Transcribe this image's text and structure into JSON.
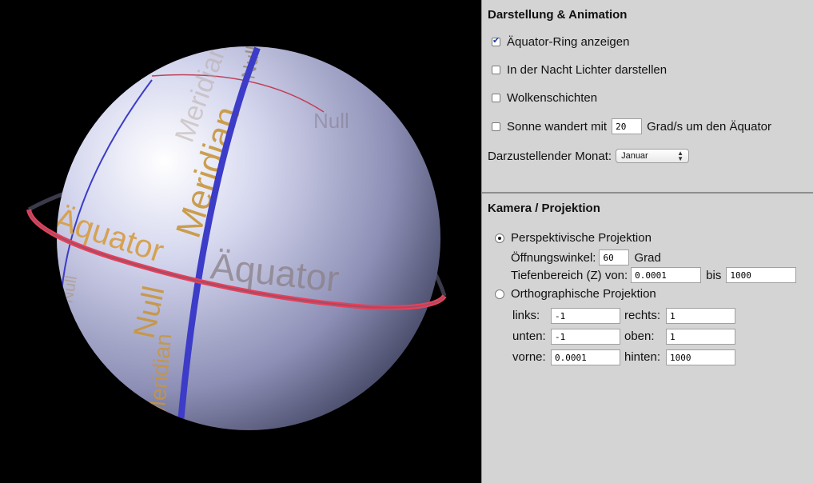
{
  "scene": {
    "globe_labels": [
      "Meridian",
      "Äquator",
      "Null",
      "Meridian",
      "Äquator",
      "Null",
      "Meridian",
      "Null",
      "Null"
    ]
  },
  "display": {
    "title": "Darstellung & Animation",
    "equator_ring": {
      "label": "Äquator-Ring anzeigen",
      "checked": true
    },
    "night_lights": {
      "label": "In der Nacht Lichter darstellen",
      "checked": false
    },
    "clouds": {
      "label": "Wolkenschichten",
      "checked": false
    },
    "sun": {
      "label_before": "Sonne wandert mit",
      "value": "20",
      "label_after": "Grad/s um den Äquator",
      "checked": false
    },
    "month": {
      "label": "Darzustellender Monat:",
      "value": "Januar"
    }
  },
  "camera": {
    "title": "Kamera / Projektion",
    "perspective": {
      "label": "Perspektivische Projektion",
      "selected": true,
      "fov_label": "Öffnungswinkel:",
      "fov_value": "60",
      "fov_unit": "Grad",
      "depth_label": "Tiefenbereich (Z) von:",
      "depth_from": "0.0001",
      "depth_to_label": "bis",
      "depth_to": "1000"
    },
    "ortho": {
      "label": "Orthographische Projektion",
      "selected": false,
      "left_label": "links:",
      "left_value": "-1",
      "right_label": "rechts:",
      "right_value": "1",
      "bottom_label": "unten:",
      "bottom_value": "-1",
      "top_label": "oben:",
      "top_value": "1",
      "near_label": "vorne:",
      "near_value": "0.0001",
      "far_label": "hinten:",
      "far_value": "1000"
    }
  },
  "colors": {
    "meridian_band": "#3c3cc8",
    "equator_ring": "#e8405a",
    "label_gold": "#c8963c"
  }
}
